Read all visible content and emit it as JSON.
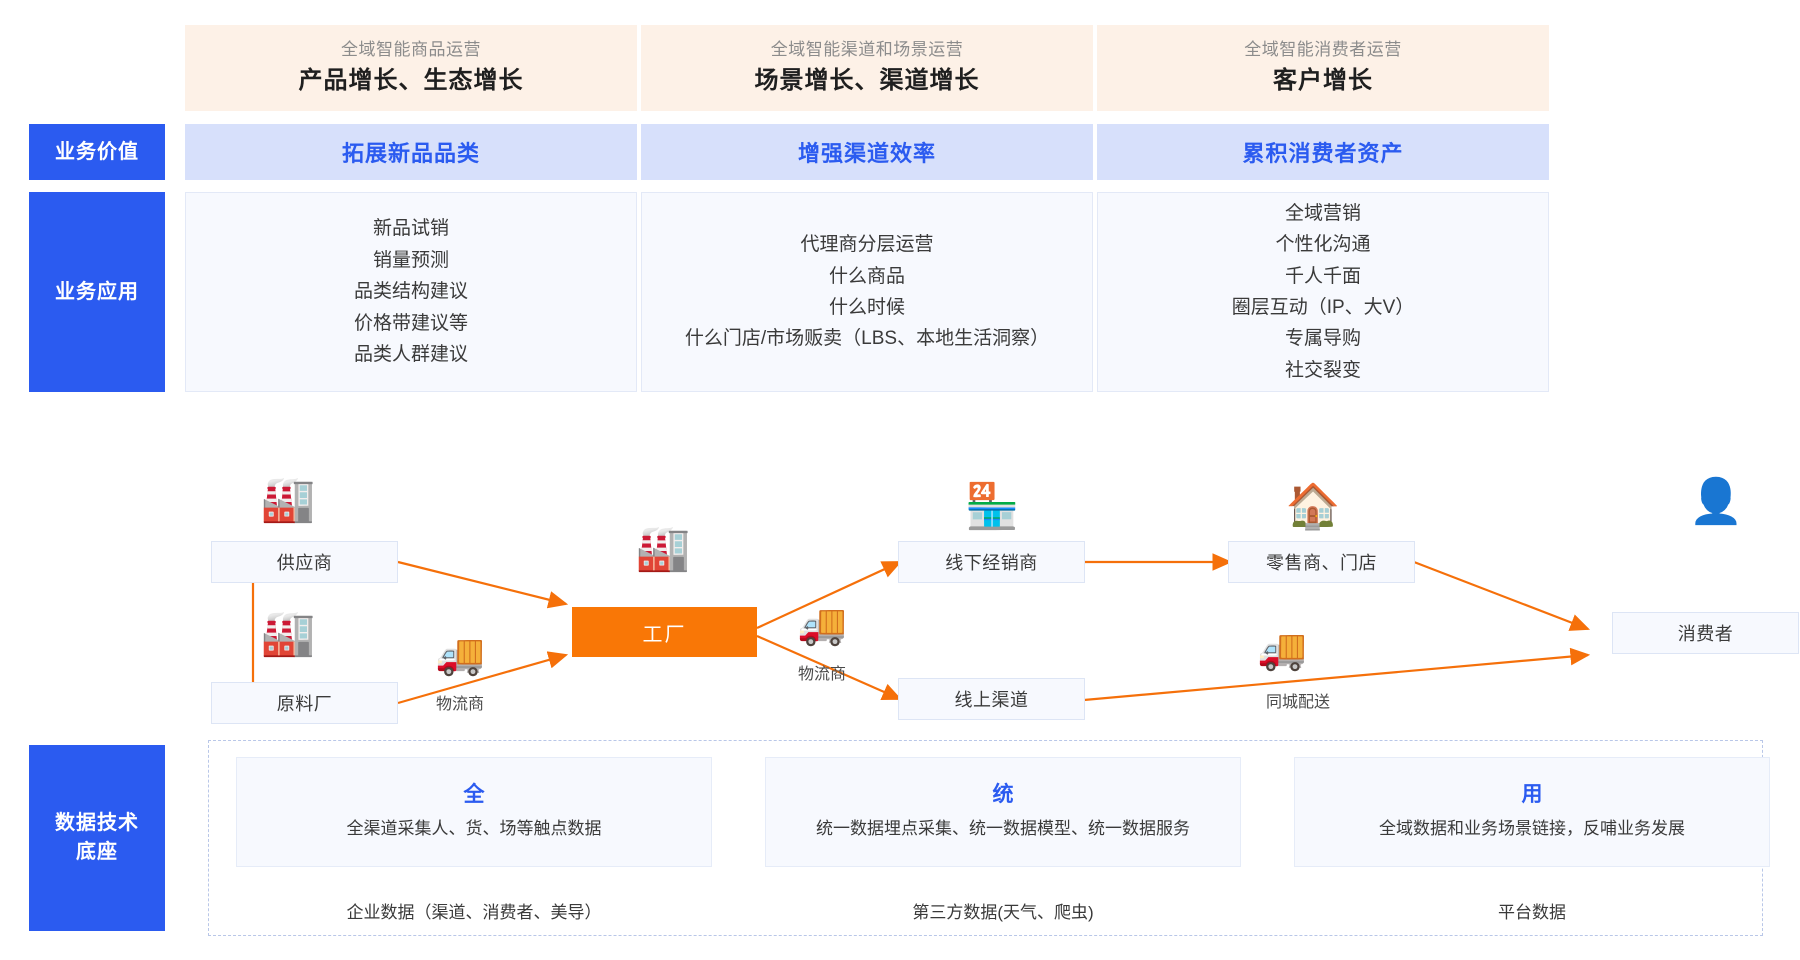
{
  "colors": {
    "accent_blue": "#2b5bf0",
    "value_band": "#d7e0fb",
    "strategy_band": "#fdf1e7",
    "card_bg": "#f7f9fe",
    "arrow_orange": "#f5700a",
    "factory_orange": "#f97706"
  },
  "strategy_columns": [
    {
      "subtitle": "全域智能商品运营",
      "title": "产品增长、生态增长"
    },
    {
      "subtitle": "全域智能渠道和场景运营",
      "title": "场景增长、渠道增长"
    },
    {
      "subtitle": "全域智能消费者运营",
      "title": "客户增长"
    }
  ],
  "rows": {
    "business_value": {
      "label": "业务价值",
      "cards": [
        "拓展新品品类",
        "增强渠道效率",
        "累积消费者资产"
      ]
    },
    "business_application": {
      "label": "业务应用",
      "columns": [
        {
          "items": [
            "新品试销",
            "销量预测",
            "品类结构建议",
            "价格带建议等",
            "品类人群建议"
          ]
        },
        {
          "items": [
            "代理商分层运营",
            "什么商品",
            "什么时候",
            "什么门店/市场贩卖（LBS、本地生活洞察）"
          ]
        },
        {
          "items": [
            "全域营销",
            "个性化沟通",
            "千人千面",
            "圈层互动（IP、大V）",
            "专属导购",
            "社交裂变"
          ]
        }
      ]
    },
    "data_foundation": {
      "label": "数据技术\n底座",
      "label_lines": [
        "数据技术",
        "底座"
      ],
      "cards": [
        {
          "key": "全",
          "desc": "全渠道采集人、货、场等触点数据",
          "source": "企业数据（渠道、消费者、美导）"
        },
        {
          "key": "统",
          "desc": "统一数据埋点采集、统一数据模型、统一数据服务",
          "source": "第三方数据(天气、爬虫)"
        },
        {
          "key": "用",
          "desc": "全域数据和业务场景链接，反哺业务发展",
          "source": "平台数据"
        }
      ]
    }
  },
  "flow": {
    "nodes": [
      {
        "id": "supplier",
        "label": "供应商",
        "icon": "factory-icon",
        "glyph": "🏭"
      },
      {
        "id": "material",
        "label": "原料厂",
        "icon": "factory-icon",
        "glyph": "🏭"
      },
      {
        "id": "factory",
        "label": "工厂",
        "icon": "industrial-plant-icon",
        "glyph": "🏭"
      },
      {
        "id": "offline",
        "label": "线下经销商",
        "icon": "store-icon",
        "glyph": "🏪"
      },
      {
        "id": "online",
        "label": "线上渠道",
        "icon": "none",
        "glyph": ""
      },
      {
        "id": "retailer",
        "label": "零售商、门店",
        "icon": "shop-house-icon",
        "glyph": "🏠"
      },
      {
        "id": "consumer",
        "label": "消费者",
        "icon": "user-avatar-icon",
        "glyph": "👤"
      }
    ],
    "captions": [
      {
        "id": "logistics-left",
        "label": "物流商",
        "icon": "truck-icon",
        "glyph": "🚚"
      },
      {
        "id": "logistics-mid",
        "label": "物流商",
        "icon": "truck-icon",
        "glyph": "🚚"
      },
      {
        "id": "city-delivery",
        "label": "同城配送",
        "icon": "truck-icon",
        "glyph": "🚚"
      }
    ]
  }
}
